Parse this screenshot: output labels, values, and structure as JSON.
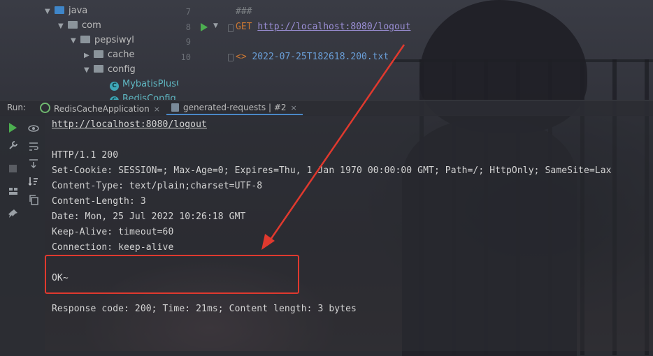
{
  "tree": {
    "items": [
      {
        "label": "java",
        "type": "folder-blue",
        "expanded": true
      },
      {
        "label": "com",
        "type": "package",
        "expanded": true
      },
      {
        "label": "pepsiwyl",
        "type": "package",
        "expanded": true
      },
      {
        "label": "cache",
        "type": "package",
        "expanded": false
      },
      {
        "label": "config",
        "type": "package",
        "expanded": true
      },
      {
        "label": "MybatisPlusCo",
        "type": "class"
      },
      {
        "label": "RedisConfig",
        "type": "class"
      }
    ]
  },
  "editor": {
    "line_numbers": [
      "7",
      "8",
      "9",
      "10"
    ],
    "line7": "###",
    "line8_method": "GET",
    "line8_url": "http://localhost:8080/logout",
    "line10_prefix": "<>",
    "line10_file": "2022-07-25T182618.200.txt"
  },
  "run_bar": {
    "label": "Run:",
    "tabs": [
      {
        "label": "RedisCacheApplication",
        "close": "×"
      },
      {
        "label": "generated-requests | #2",
        "close": "×"
      }
    ]
  },
  "console": {
    "url": "http://localhost:8080/logout",
    "lines": [
      "HTTP/1.1 200",
      "Set-Cookie: SESSION=; Max-Age=0; Expires=Thu, 1 Jan 1970 00:00:00 GMT; Path=/; HttpOnly; SameSite=Lax",
      "Content-Type: text/plain;charset=UTF-8",
      "Content-Length: 3",
      "Date: Mon, 25 Jul 2022 10:26:18 GMT",
      "Keep-Alive: timeout=60",
      "Connection: keep-alive"
    ],
    "body": "OK~",
    "summary": "Response code: 200; Time: 21ms; Content length: 3 bytes"
  },
  "colors": {
    "annotation": "#e0392e",
    "run_green": "#4caf50",
    "tab_accent": "#4a88c7"
  }
}
